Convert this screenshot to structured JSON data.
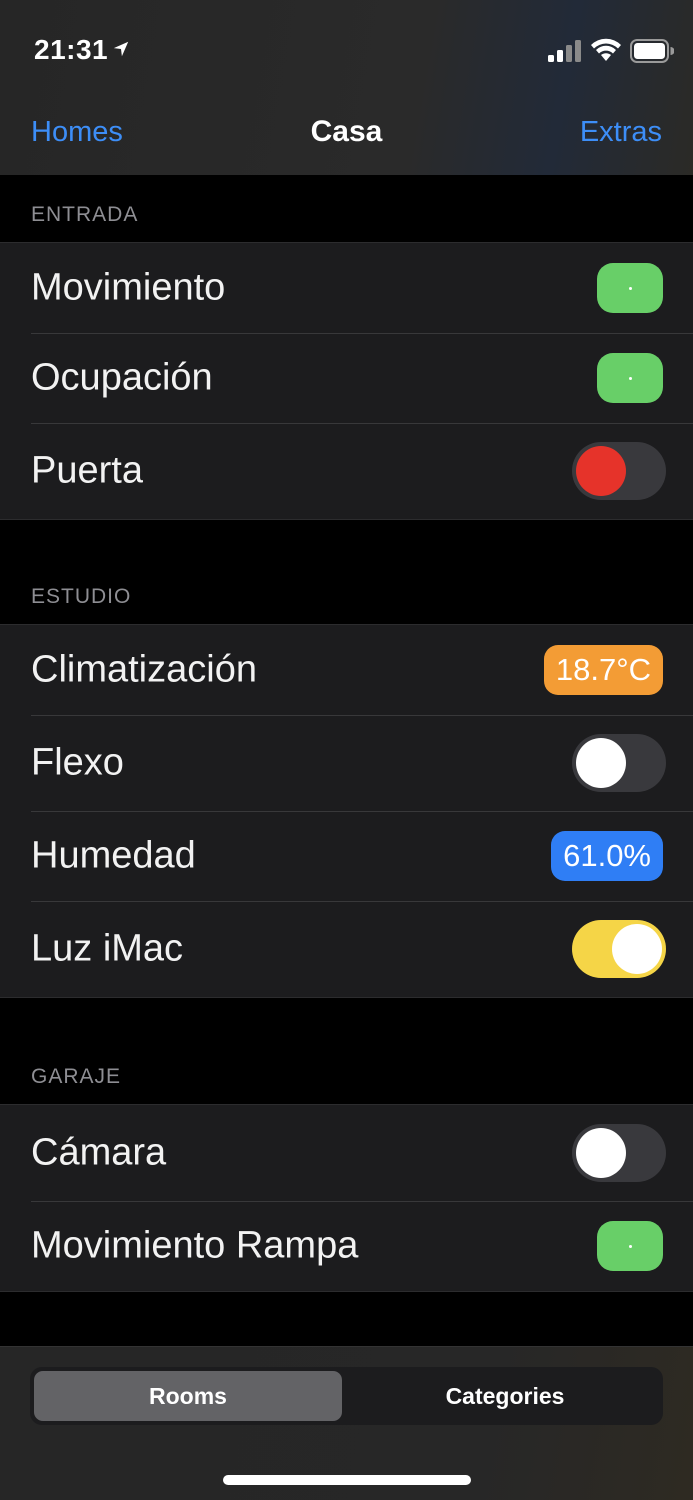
{
  "status_bar": {
    "time": "21:31"
  },
  "nav": {
    "left": "Homes",
    "title": "Casa",
    "right": "Extras"
  },
  "sections": [
    {
      "header": "ENTRADA",
      "rows": [
        {
          "label": "Movimiento",
          "control": "sensor-on"
        },
        {
          "label": "Ocupación",
          "control": "sensor-on"
        },
        {
          "label": "Puerta",
          "control": "toggle-red"
        }
      ]
    },
    {
      "header": "ESTUDIO",
      "rows": [
        {
          "label": "Climatización",
          "control": "badge",
          "value": "18.7°C",
          "color": "#f39c35"
        },
        {
          "label": "Flexo",
          "control": "toggle-off"
        },
        {
          "label": "Humedad",
          "control": "badge",
          "value": "61.0%",
          "color": "#2f7ef5"
        },
        {
          "label": "Luz iMac",
          "control": "toggle-on"
        }
      ]
    },
    {
      "header": "GARAJE",
      "rows": [
        {
          "label": "Cámara",
          "control": "toggle-off"
        },
        {
          "label": "Movimiento Rampa",
          "control": "sensor-on"
        }
      ]
    }
  ],
  "tabs": {
    "rooms": "Rooms",
    "categories": "Categories",
    "selected": "Rooms"
  },
  "colors": {
    "accent": "#3d8ef7",
    "sensor_green": "#68cf68",
    "toggle_yellow": "#f5d547",
    "alert_red": "#e6332a"
  }
}
